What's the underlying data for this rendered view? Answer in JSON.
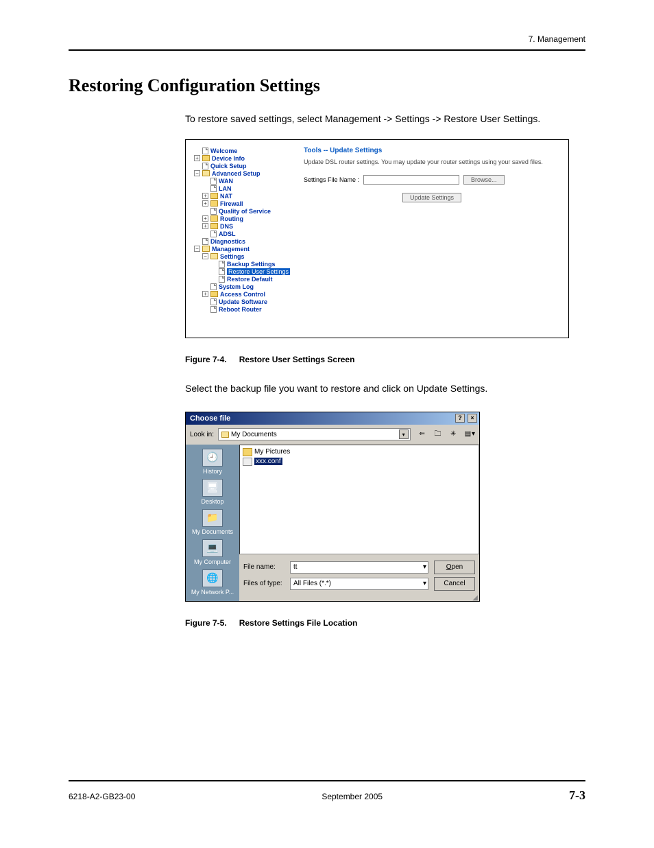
{
  "header": {
    "chapter": "7. Management"
  },
  "section_title": "Restoring Configuration Settings",
  "intro": "To restore saved settings, select Management -> Settings -> Restore User Settings.",
  "router": {
    "tree": {
      "welcome": "Welcome",
      "device_info": "Device Info",
      "quick_setup": "Quick Setup",
      "advanced_setup": "Advanced Setup",
      "wan": "WAN",
      "lan": "LAN",
      "nat": "NAT",
      "firewall": "Firewall",
      "qos": "Quality of Service",
      "routing": "Routing",
      "dns": "DNS",
      "adsl": "ADSL",
      "diagnostics": "Diagnostics",
      "management": "Management",
      "settings": "Settings",
      "backup": "Backup Settings",
      "restore_user": "Restore User Settings",
      "restore_default": "Restore Default",
      "system_log": "System Log",
      "access_control": "Access Control",
      "update_software": "Update Software",
      "reboot": "Reboot Router"
    },
    "panel": {
      "title": "Tools -- Update Settings",
      "desc": "Update DSL router settings. You may update your router settings using your saved files.",
      "file_label": "Settings File Name :",
      "browse": "Browse...",
      "update": "Update Settings"
    }
  },
  "caption1_num": "Figure 7-4.",
  "caption1_text": "Restore User Settings Screen",
  "mid_text": "Select the backup file you want to restore and click on Update Settings.",
  "dialog": {
    "title": "Choose file",
    "help_btn": "?",
    "close_btn": "×",
    "lookin_label": "Look in:",
    "lookin_value": "My Documents",
    "toolbar": {
      "back": "⇐",
      "up": "🗀",
      "new": "✳",
      "view": "▤"
    },
    "places": {
      "history": "History",
      "desktop": "Desktop",
      "mydocs": "My Documents",
      "mycomp": "My Computer",
      "mynet": "My Network P..."
    },
    "files": {
      "pictures": "My Pictures",
      "selected": "xxx.conf"
    },
    "filename_label": "File name:",
    "filename_value": "tt",
    "filetype_label": "Files of type:",
    "filetype_value": "All Files (*.*)",
    "open": "Open",
    "cancel": "Cancel"
  },
  "caption2_num": "Figure 7-5.",
  "caption2_text": "Restore Settings File Location",
  "footer": {
    "doc_id": "6218-A2-GB23-00",
    "date": "September 2005",
    "page": "7-3"
  }
}
